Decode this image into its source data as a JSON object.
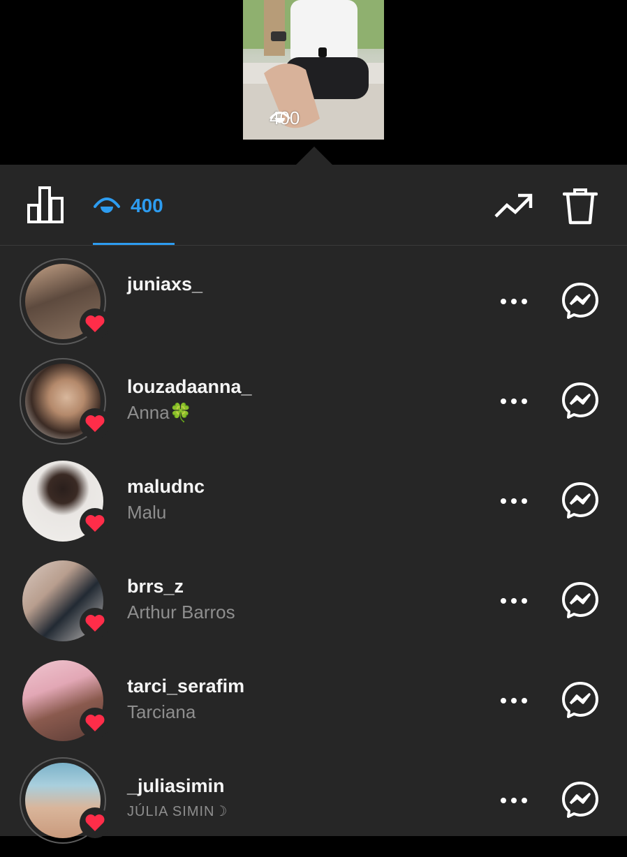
{
  "story": {
    "view_count": "400"
  },
  "toolbar": {
    "views_count": "400"
  },
  "viewers": [
    {
      "username": "juniaxs_",
      "full_name": "",
      "liked": true,
      "avatar_colors": [
        "#6e5a4a",
        "#c9a68a"
      ]
    },
    {
      "username": "louzadaanna_",
      "full_name": "Anna🍀",
      "liked": true,
      "avatar_colors": [
        "#3b2b24",
        "#d8b79c"
      ]
    },
    {
      "username": "maludnc",
      "full_name": "Malu",
      "liked": true,
      "avatar_colors": [
        "#e9e6e3",
        "#2a1f1c"
      ]
    },
    {
      "username": "brrs_z",
      "full_name": "Arthur Barros",
      "liked": true,
      "avatar_colors": [
        "#c3b8b2",
        "#222a33"
      ]
    },
    {
      "username": "tarci_serafim",
      "full_name": "Tarciana",
      "liked": true,
      "avatar_colors": [
        "#e2a7b5",
        "#5b3c36"
      ]
    },
    {
      "username": "_juliasimin",
      "full_name": "JÚLIA SIMIN☽",
      "liked": true,
      "avatar_colors": [
        "#7bb2c9",
        "#d9b59a"
      ]
    }
  ],
  "colors": {
    "accent": "#2d9cf0",
    "heart": "#ff2d49",
    "sheet_bg": "#262626"
  }
}
